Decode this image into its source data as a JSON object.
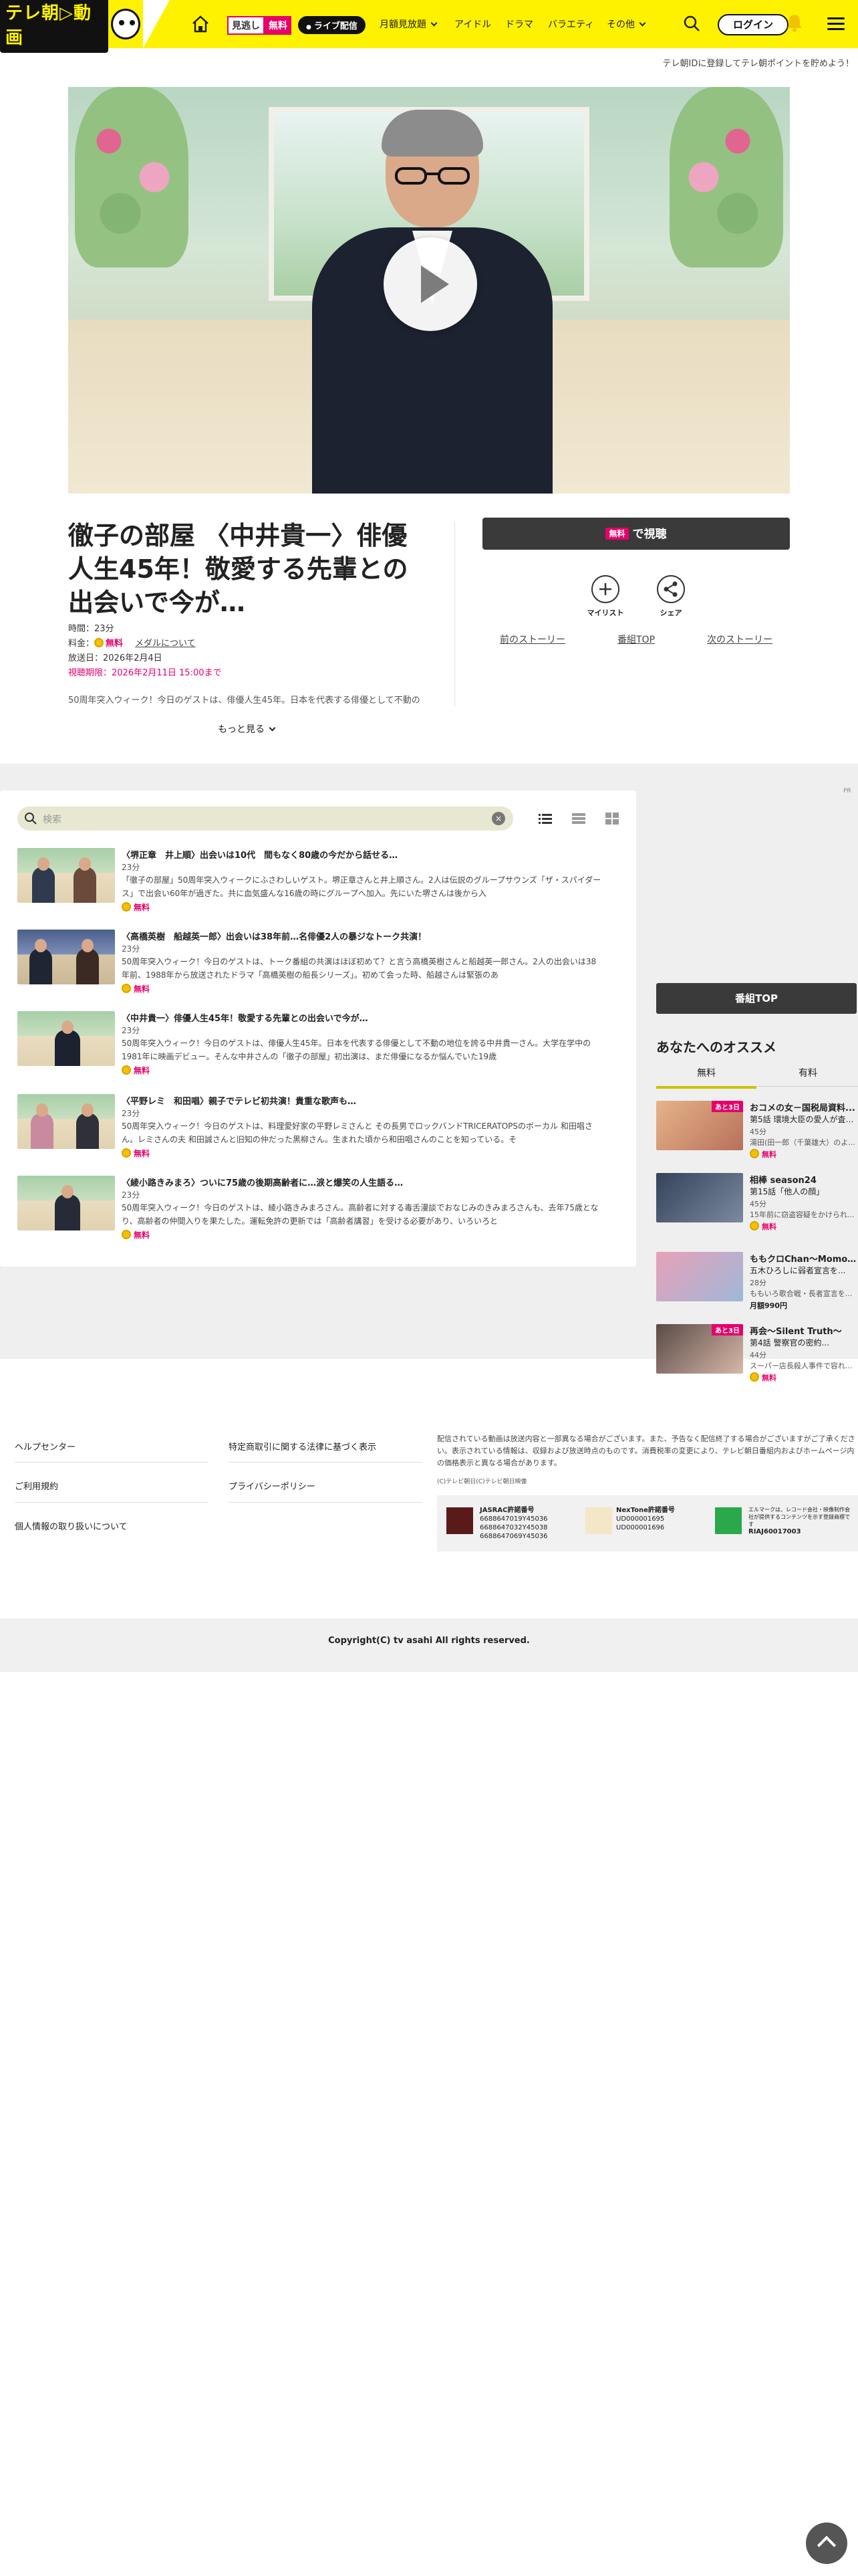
{
  "header": {
    "logo_text": "テレ朝▷動画",
    "badge_left": "見逃し",
    "badge_right": "無料",
    "live_label": "ライブ配信",
    "nav": [
      "月額見放題",
      "アイドル",
      "ドラマ",
      "バラエティ",
      "その他"
    ],
    "login_label": "ログイン",
    "brand_color": "#fff200",
    "accent_color": "#e5006a"
  },
  "subbar_text": "テレ朝IDに登録してテレ朝ポイントを貯めよう！",
  "program": {
    "title": "徹子の部屋 〈中井貴一〉俳優人生45年！敬愛する先輩との出会いで今が…",
    "duration_label": "時間：23分",
    "price_label": "料金：",
    "price_value": "無料",
    "membership_link": "メダルについて",
    "air_date": "放送日：2026年2月4日",
    "deadline": "視聴期限：2026年2月11日 15:00まで",
    "description": "50周年突入ウィーク！今日のゲストは、俳優人生45年。日本を代表する俳優として不動の",
    "more_label": "もっと見る",
    "watch_free_badge": "無料",
    "watch_label": "で視聴",
    "mylist_label": "マイリスト",
    "share_label": "シェア",
    "prev_story": "前のストーリー",
    "program_top": "番組TOP",
    "next_story": "次のストーリー"
  },
  "episodes": {
    "search_placeholder": "検索",
    "items": [
      {
        "title": "〈堺正章　井上順〉出会いは10代　間もなく80歳の今だから話せる…",
        "duration": "23分",
        "description": "「徹子の部屋」50周年突入ウィークにふさわしいゲスト。堺正章さんと井上順さん。2人は伝説のグループサウンズ「ザ・スパイダース」で出会い60年が過ぎた。共に血気盛んな16歳の時にグループへ加入。先にいた堺さんは後から入",
        "free": "無料"
      },
      {
        "title": "〈高橋英樹　船越英一郎〉出会いは38年前…名俳優2人の暴ジなトーク共演！",
        "duration": "23分",
        "description": "50周年突入ウィーク！今日のゲストは、トーク番組の共演はほぼ初めて？と言う高橋英樹さんと船越英一郎さん。2人の出会いは38年前、1988年から放送されたドラマ「高橋英樹の船長シリーズ」。初めて会った時、船越さんは緊張のあ",
        "free": "無料"
      },
      {
        "title": "〈中井貴一〉俳優人生45年！敬愛する先輩との出会いで今が…",
        "duration": "23分",
        "description": "50周年突入ウィーク！今日のゲストは、俳優人生45年。日本を代表する俳優として不動の地位を誇る中井貴一さん。大学在学中の1981年に映画デビュー。そんな中井さんの「徹子の部屋」初出演は、まだ俳優になるか悩んでいた19歳",
        "free": "無料"
      },
      {
        "title": "〈平野レミ　和田唱〉親子でテレビ初共演！貴重な歌声も…",
        "duration": "23分",
        "description": "50周年突入ウィーク！今日のゲストは、料理愛好家の平野レミさんと その長男でロックバンドTRICERATOPSのボーカル 和田唱さん。レミさんの夫 和田誠さんと旧知の仲だった黒柳さん。生まれた頃から和田唱さんのことを知っている。そ",
        "free": "無料"
      },
      {
        "title": "〈綾小路きみまろ〉ついに75歳の後期高齢者に…涙と爆笑の人生語る…",
        "duration": "23分",
        "description": "50周年突入ウィーク！今日のゲストは、綾小路きみまろさん。高齢者に対する毒舌漫談でおなじみのきみまろさんも、去年75歳となり、高齢者の仲間入りを果たした。運転免許の更新では「高齢者講習」を受ける必要があり、いろいろと",
        "free": "無料"
      }
    ]
  },
  "ad_label": "PR",
  "sidebar": {
    "top_button": "番組TOP",
    "rec_title": "あなたへのオススメ",
    "tab_free": "無料",
    "tab_paid": "有料",
    "items": [
      {
        "badge": "あと3日",
        "title": "おコメの女－国税局資料...",
        "sub": "第5話 環境大臣の愛人が査察...",
        "duration": "45分",
        "desc": "湯田(田一郎（千葉雄大）のよ...",
        "price": "無料"
      },
      {
        "badge": "",
        "title": "相棒 season24",
        "sub": "第15話「他人の顔」",
        "duration": "45分",
        "desc": "15年前に窃盗容疑をかけられ...",
        "price": "無料"
      },
      {
        "badge": "",
        "title": "ももクロChan～Momo...",
        "sub": "五木ひろしに弱者宣言を...",
        "duration": "28分",
        "desc": "ももいろ歌合戦・長者宣言を...",
        "price": "月額990円"
      },
      {
        "badge": "あと3日",
        "title": "再会～Silent Truth～",
        "sub": "第4話 警察官の密約...",
        "duration": "44分",
        "desc": "スーパー店長殺人事件で容れ...",
        "price": "無料"
      }
    ]
  },
  "footer": {
    "links_left": [
      "ヘルプセンター",
      "ご利用規約",
      "個人情報の取り扱いについて"
    ],
    "links_right": [
      "特定商取引に関する法律に基づく表示",
      "プライバシーポリシー"
    ],
    "note": "配信されている動画は放送内容と一部異なる場合がございます。また、予告なく配信終了する場合がございますがご了承ください。表示されている情報は、収録および放送時点のものです。消費税率の変更により、テレビ朝日番組内およびホームページ内の価格表示と異なる場合があります。",
    "small": "(C)テレビ朝日(C)テレビ朝日映像",
    "licenses": [
      {
        "name": "JASRAC許諾番号",
        "numbers": [
          "6688647019Y45036",
          "6688647032Y45038",
          "6688647069Y45036"
        ]
      },
      {
        "name": "NexTone許諾番号",
        "numbers": [
          "UD000001695",
          "UD000001696"
        ]
      },
      {
        "name": "RIAJ",
        "numbers": [
          "エルマークは、レコード会社・映像制作会社が提供するコンテンツを示す登録商標です",
          "RIAJ60017003"
        ]
      }
    ],
    "copyright": "Copyright(C) tv asahi All rights reserved."
  }
}
